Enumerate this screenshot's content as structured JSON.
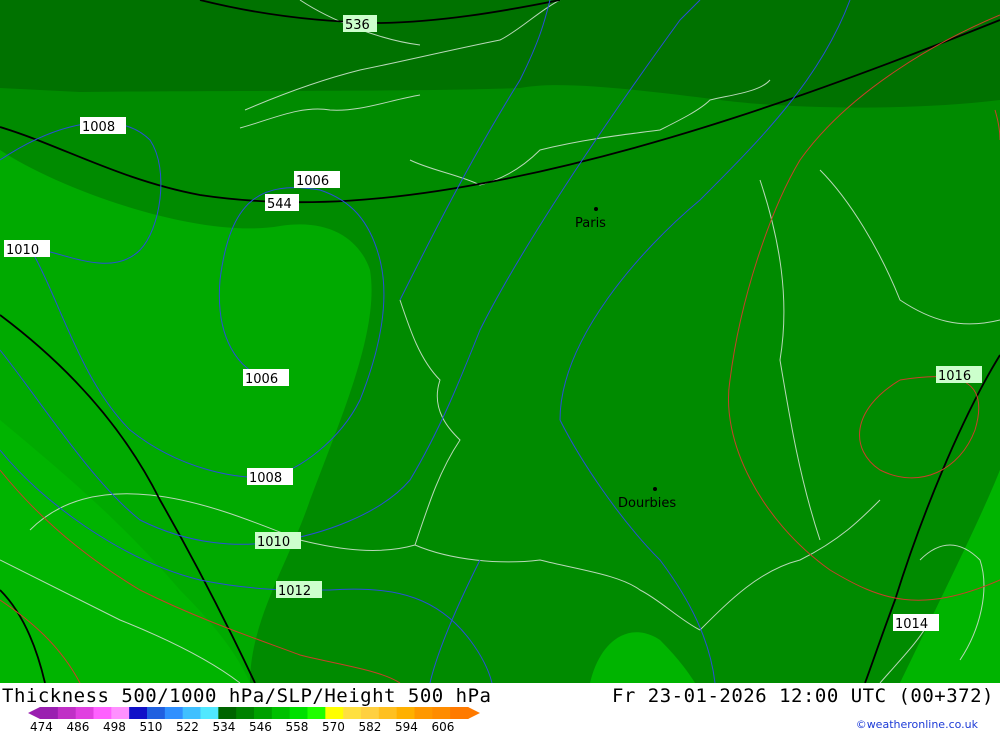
{
  "map": {
    "cities": [
      {
        "name": "Paris"
      },
      {
        "name": "Dourbies"
      }
    ],
    "isobar_labels": [
      "1008",
      "1006",
      "1010",
      "1006",
      "1008",
      "1010",
      "1012",
      "1016",
      "1014"
    ],
    "thickness_labels": [
      "536",
      "544"
    ]
  },
  "footer": {
    "title": "Thickness 500/1000 hPa/SLP/Height 500 hPa",
    "timestamp": "Fr 23-01-2026 12:00 UTC (00+372)",
    "credit": "©weatheronline.co.uk",
    "scale_values": [
      "474",
      "486",
      "498",
      "510",
      "522",
      "534",
      "546",
      "558",
      "570",
      "582",
      "594",
      "606"
    ],
    "scale_colors": [
      "#9a1fb0",
      "#c02fc6",
      "#e040e0",
      "#ff60ff",
      "#ff90ff",
      "#1010c8",
      "#2060e0",
      "#3090ff",
      "#40c0ff",
      "#50e8ff",
      "#006400",
      "#008200",
      "#00a000",
      "#00c000",
      "#00e000",
      "#20ff00",
      "#ffff00",
      "#ffe040",
      "#ffd040",
      "#ffc020",
      "#ffb000",
      "#ff9800",
      "#ff8c00",
      "#ff7a00"
    ]
  }
}
